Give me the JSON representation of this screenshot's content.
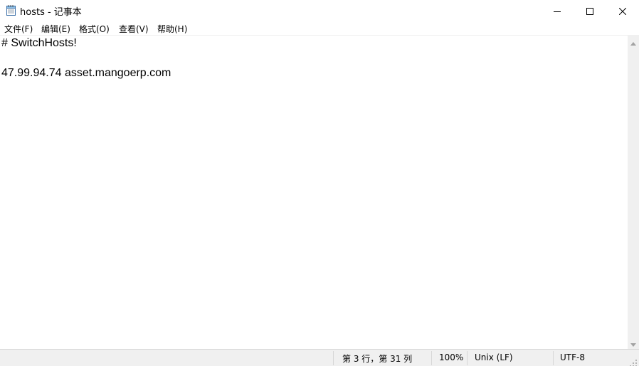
{
  "window": {
    "title": "hosts - 记事本",
    "icon": "notepad-icon"
  },
  "controls": {
    "minimize_icon": "minimize-icon",
    "maximize_icon": "maximize-icon",
    "close_icon": "close-icon"
  },
  "menu": {
    "items": [
      {
        "label": "文件(F)"
      },
      {
        "label": "编辑(E)"
      },
      {
        "label": "格式(O)"
      },
      {
        "label": "查看(V)"
      },
      {
        "label": "帮助(H)"
      }
    ]
  },
  "editor": {
    "lines": [
      "# SwitchHosts!",
      "",
      "47.99.94.74 asset.mangoerp.com"
    ]
  },
  "statusbar": {
    "position": "第 3 行，第 31 列",
    "zoom": "100%",
    "line_ending": "Unix (LF)",
    "encoding": "UTF-8"
  }
}
